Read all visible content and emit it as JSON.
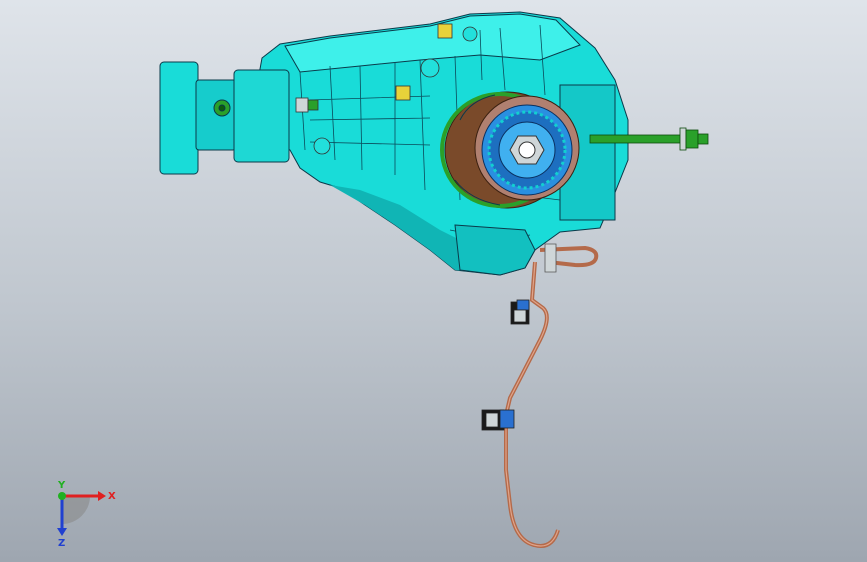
{
  "viewport": {
    "background_top": "#dfe4ea",
    "background_bottom": "#9ea6b0"
  },
  "model": {
    "body_color": "#19dcd8",
    "edge_color": "#0a3a4a",
    "shaft_color": "#2aa02a",
    "pipe_color": "#b46a4a",
    "rotor_color": "#2a8fe0"
  },
  "triad": {
    "x_label": "X",
    "y_label": "Y",
    "z_label": "Z",
    "x_color": "#e02020",
    "y_color": "#20b020",
    "z_color": "#2040d0"
  }
}
